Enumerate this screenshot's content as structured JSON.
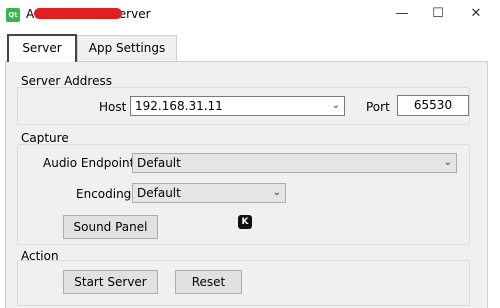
{
  "window": {
    "app_icon_label": "Qt",
    "title": "Audio Stream Server",
    "minimize_glyph": "—",
    "maximize_glyph": "☐",
    "close_glyph": "✕"
  },
  "tabs": [
    {
      "label": "Server",
      "active": true
    },
    {
      "label": "App Settings",
      "active": false
    }
  ],
  "server_address": {
    "group_title": "Server Address",
    "host_label": "Host",
    "host_value": "192.168.31.11",
    "port_label": "Port",
    "port_value": "65530"
  },
  "capture": {
    "group_title": "Capture",
    "endpoint_label": "Audio Endpoint",
    "endpoint_value": "Default",
    "encoding_label": "Encoding",
    "encoding_value": "Default",
    "sound_panel_label": "Sound Panel"
  },
  "action": {
    "group_title": "Action",
    "start_label": "Start Server",
    "reset_label": "Reset"
  },
  "overlay_icon": {
    "name": "k-icon",
    "glyph": "K"
  },
  "colors": {
    "app_icon": "#2fb84e",
    "redaction": "#e02020",
    "panel_bg": "#f0f0f0",
    "button_bg": "#e1e1e1"
  }
}
